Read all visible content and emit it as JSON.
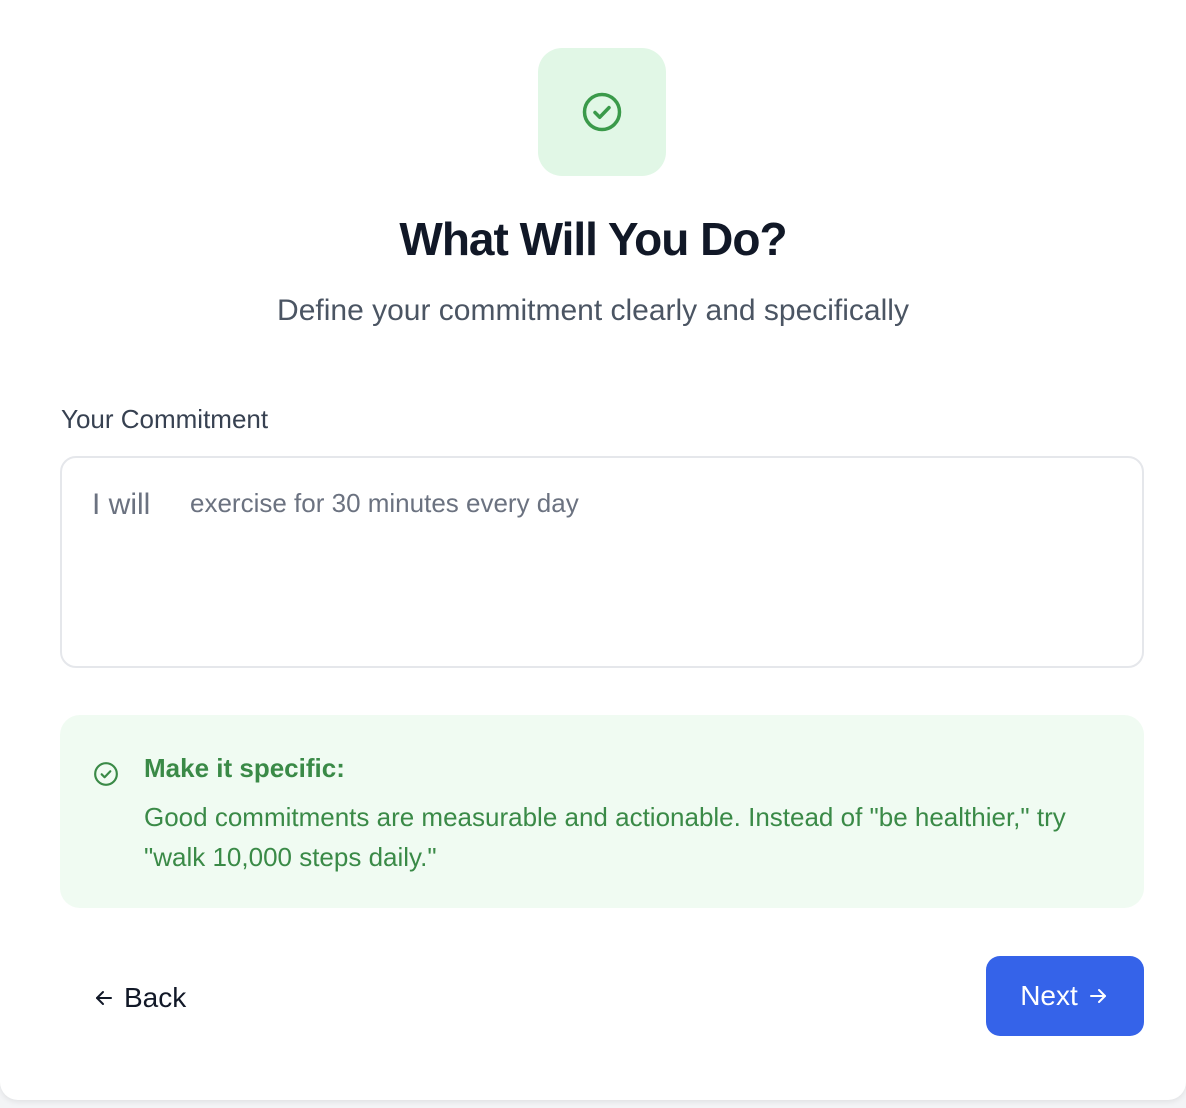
{
  "header": {
    "icon": "check-circle-icon",
    "title": "What Will You Do?",
    "subtitle": "Define your commitment clearly and specifically"
  },
  "commitment": {
    "label": "Your Commitment",
    "prefix": "I will",
    "value": "exercise for 30 minutes every day"
  },
  "tip": {
    "icon": "check-circle-icon",
    "title": "Make it specific:",
    "body": "Good commitments are measurable and actionable. Instead of \"be healthier,\" try \"walk 10,000 steps daily.\""
  },
  "nav": {
    "back_label": "Back",
    "next_label": "Next",
    "back_icon": "arrow-left-icon",
    "next_icon": "arrow-right-icon"
  },
  "colors": {
    "accent": "#3563e9",
    "success": "#3a8a47",
    "success_bg": "#f0fbf2",
    "icon_bg": "#e1f7e6"
  }
}
